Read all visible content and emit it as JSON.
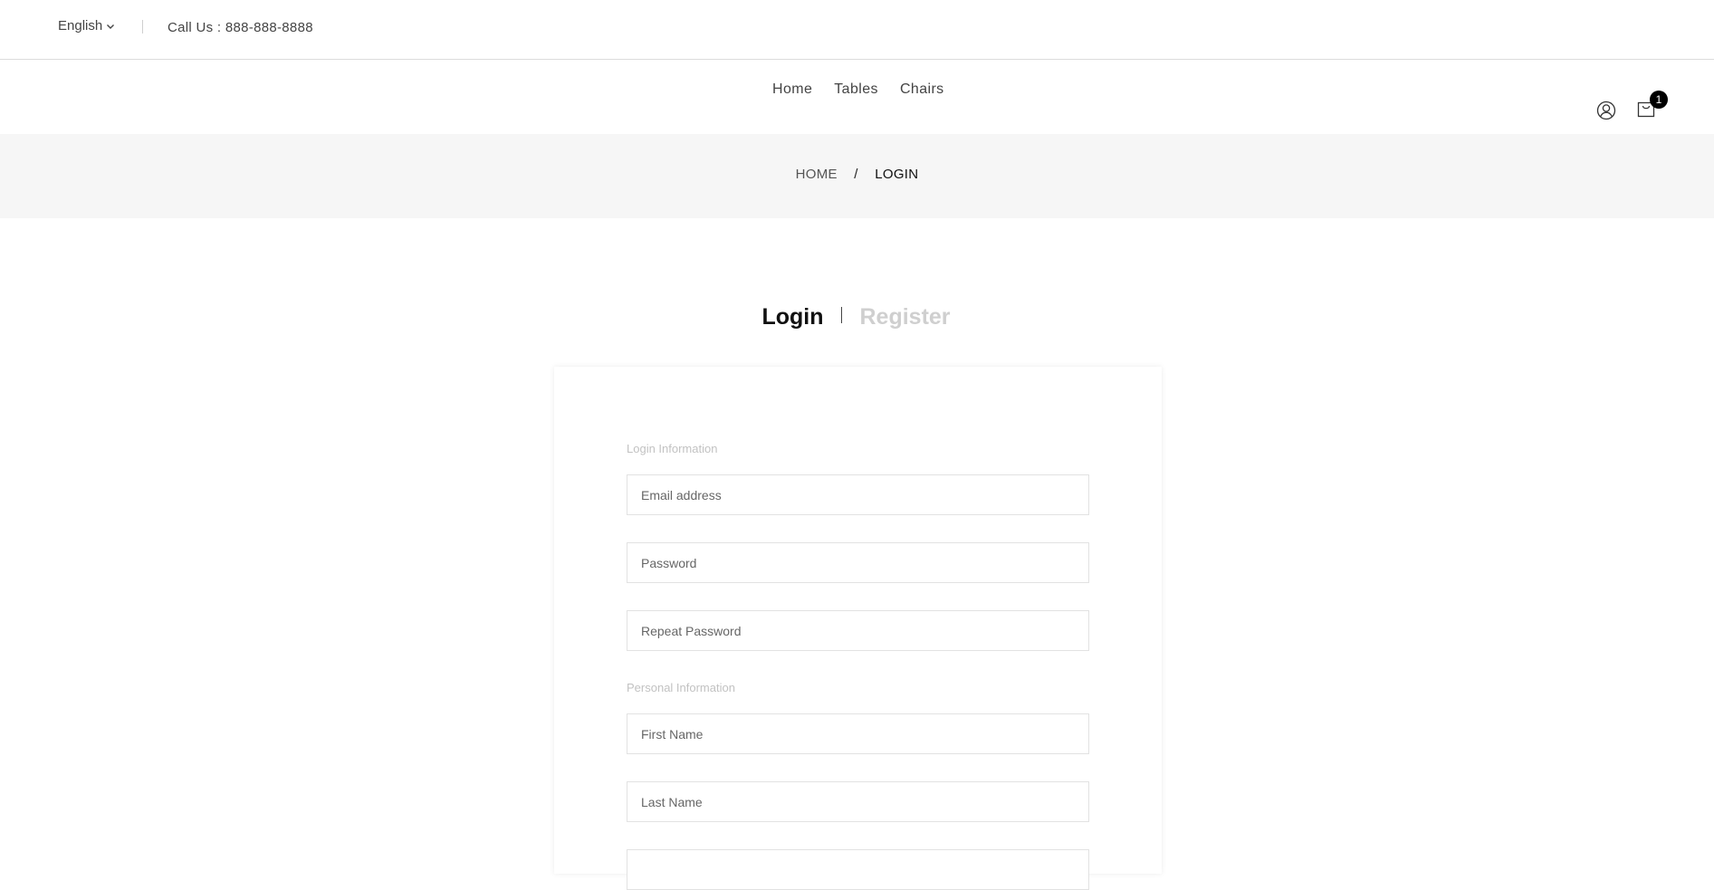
{
  "topbar": {
    "language": "English",
    "call_us": "Call Us : 888-888-8888"
  },
  "nav": {
    "links": [
      "Home",
      "Tables",
      "Chairs"
    ],
    "cart_count": "1"
  },
  "breadcrumb": {
    "home": "HOME",
    "separator": "/",
    "current": "LOGIN"
  },
  "tabs": {
    "login": "Login",
    "register": "Register"
  },
  "form": {
    "login_section_label": "Login Information",
    "email_placeholder": "Email address",
    "password_placeholder": "Password",
    "repeat_password_placeholder": "Repeat Password",
    "personal_section_label": "Personal Information",
    "first_name_placeholder": "First Name",
    "last_name_placeholder": "Last Name"
  },
  "colors": {
    "breadcrumb_band": "#f6f6f6",
    "inactive_tab": "#cfcfcf",
    "section_label": "#c2c2c2",
    "badge": "#000000"
  },
  "icons": [
    "chevron-down-icon",
    "user-icon",
    "cart-icon"
  ]
}
